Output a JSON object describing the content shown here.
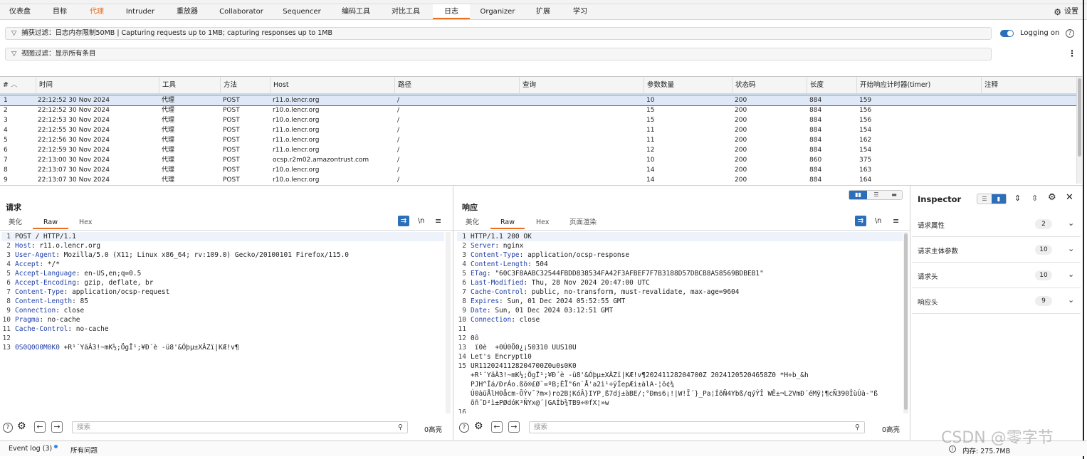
{
  "menubar": {
    "tabs": [
      "仪表盘",
      "目标",
      "代理",
      "Intruder",
      "重放器",
      "Collaborator",
      "Sequencer",
      "编码工具",
      "对比工具",
      "日志",
      "Organizer",
      "扩展",
      "学习"
    ],
    "active_tab": "日志",
    "settings_label": "设置"
  },
  "capture_filter": "捕获过滤：日志内存限制50MB | Capturing requests up to 1MB; capturing responses up to 1MB",
  "view_filter": "视图过滤：显示所有条目",
  "logging_label": "Logging on",
  "table": {
    "columns": [
      "#",
      "时间",
      "工具",
      "方法",
      "Host",
      "路径",
      "查询",
      "参数数量",
      "状态码",
      "长度",
      "开始响应计时器(timer)",
      "注释"
    ],
    "rows": [
      [
        "1",
        "22:12:52 30 Nov 2024",
        "代理",
        "POST",
        "r11.o.lencr.org",
        "/",
        "",
        "10",
        "200",
        "884",
        "159",
        ""
      ],
      [
        "2",
        "22:12:52 30 Nov 2024",
        "代理",
        "POST",
        "r10.o.lencr.org",
        "/",
        "",
        "15",
        "200",
        "884",
        "156",
        ""
      ],
      [
        "3",
        "22:12:53 30 Nov 2024",
        "代理",
        "POST",
        "r10.o.lencr.org",
        "/",
        "",
        "15",
        "200",
        "884",
        "156",
        ""
      ],
      [
        "4",
        "22:12:55 30 Nov 2024",
        "代理",
        "POST",
        "r11.o.lencr.org",
        "/",
        "",
        "11",
        "200",
        "884",
        "154",
        ""
      ],
      [
        "5",
        "22:12:56 30 Nov 2024",
        "代理",
        "POST",
        "r11.o.lencr.org",
        "/",
        "",
        "11",
        "200",
        "884",
        "162",
        ""
      ],
      [
        "6",
        "22:12:59 30 Nov 2024",
        "代理",
        "POST",
        "r11.o.lencr.org",
        "/",
        "",
        "12",
        "200",
        "884",
        "154",
        ""
      ],
      [
        "7",
        "22:13:00 30 Nov 2024",
        "代理",
        "POST",
        "ocsp.r2m02.amazontrust.com",
        "/",
        "",
        "10",
        "200",
        "860",
        "375",
        ""
      ],
      [
        "8",
        "22:13:07 30 Nov 2024",
        "代理",
        "POST",
        "r10.o.lencr.org",
        "/",
        "",
        "14",
        "200",
        "884",
        "163",
        ""
      ],
      [
        "9",
        "22:13:07 30 Nov 2024",
        "代理",
        "POST",
        "r10.o.lencr.org",
        "/",
        "",
        "14",
        "200",
        "884",
        "164",
        ""
      ]
    ]
  },
  "request": {
    "title": "请求",
    "tabs": [
      "美化",
      "Raw",
      "Hex"
    ],
    "active_tab": "Raw",
    "newline_label": "\\n",
    "lines": [
      {
        "n": "1",
        "k": "",
        "v": "POST / HTTP/1.1"
      },
      {
        "n": "2",
        "k": "Host",
        "v": ": r11.o.lencr.org"
      },
      {
        "n": "3",
        "k": "User-Agent",
        "v": ": Mozilla/5.0 (X11; Linux x86_64; rv:109.0) Gecko/20100101 Firefox/115.0"
      },
      {
        "n": "4",
        "k": "Accept",
        "v": ": */*"
      },
      {
        "n": "5",
        "k": "Accept-Language",
        "v": ": en-US,en;q=0.5"
      },
      {
        "n": "6",
        "k": "Accept-Encoding",
        "v": ": gzip, deflate, br"
      },
      {
        "n": "7",
        "k": "Content-Type",
        "v": ": application/ocsp-request"
      },
      {
        "n": "8",
        "k": "Content-Length",
        "v": ": 85"
      },
      {
        "n": "9",
        "k": "Connection",
        "v": ": close"
      },
      {
        "n": "10",
        "k": "Pragma",
        "v": ": no-cache"
      },
      {
        "n": "11",
        "k": "Cache-Control",
        "v": ": no-cache"
      },
      {
        "n": "12",
        "k": "",
        "v": ""
      },
      {
        "n": "13",
        "k": "0S0Q0O0M0K0",
        "v": " +R¹´YäÂ3!~mK½;ÖgÎ¹;¥Đ´è -ü8'&Óþµ±XÂZï|KÆ!v¶"
      }
    ],
    "search_placeholder": "搜索",
    "highlight_count": "0高亮"
  },
  "response": {
    "title": "响应",
    "tabs": [
      "美化",
      "Raw",
      "Hex",
      "页面渲染"
    ],
    "active_tab": "Raw",
    "newline_label": "\\n",
    "lines": [
      {
        "n": "1",
        "k": "",
        "v": "HTTP/1.1 200 OK"
      },
      {
        "n": "2",
        "k": "Server",
        "v": ": nginx"
      },
      {
        "n": "3",
        "k": "Content-Type",
        "v": ": application/ocsp-response"
      },
      {
        "n": "4",
        "k": "Content-Length",
        "v": ": 504"
      },
      {
        "n": "5",
        "k": "ETag",
        "v": ": \"60C3F8AABC32544FBDD838534FA42F3AFBEF7F7B3188D57DBCB8A58569BDBEB1\""
      },
      {
        "n": "6",
        "k": "Last-Modified",
        "v": ": Thu, 28 Nov 2024 20:47:00 UTC"
      },
      {
        "n": "7",
        "k": "Cache-Control",
        "v": ": public, no-transform, must-revalidate, max-age=9604"
      },
      {
        "n": "8",
        "k": "Expires",
        "v": ": Sun, 01 Dec 2024 05:52:55 GMT"
      },
      {
        "n": "9",
        "k": "Date",
        "v": ": Sun, 01 Dec 2024 03:12:51 GMT"
      },
      {
        "n": "10",
        "k": "Connection",
        "v": ": close"
      },
      {
        "n": "11",
        "k": "",
        "v": ""
      },
      {
        "n": "12",
        "k": "",
        "v": "0ô"
      },
      {
        "n": "13",
        "k": "",
        "v": " ï0è  +0Ú0Ö0¿¡50310 UUS10U"
      },
      {
        "n": "14",
        "k": "",
        "v": "Let's Encrypt10"
      },
      {
        "n": "15",
        "k": "",
        "v": "UR1120241128204700Z0u0s0K0"
      },
      {
        "n": "",
        "k": "",
        "v": "+R¹´YäÂ3!~mK½;ÖgÎ¹;¥Đ´è -ü8'&Óþµ±XÂZï|KÆ!v¶20241128204700Z 20241205204658Z0 *H÷b_&h"
      },
      {
        "n": "",
        "k": "",
        "v": "PJH^Íá/ÐrÁo.ßõ®£Ø¨=ºB;ÈÏ\"6n`Å'a2ì¹÷ÿÍepÆi±àlA-¦õ¢¾"
      },
      {
        "n": "",
        "k": "",
        "v": "Ú0àüÅlH0åcm-ÕÝv¯?m×)ro2B¦KóÂ}IYP¸ß7dj±àBE/;°Ðms6¡!|W!Ï´}_Pa¦ÍõÑ4Ybß/qýÝÎ WÊ±¬L2VmÐ´éMÿ¦¶cÑ390ÎùÙà-\"ß"
      },
      {
        "n": "",
        "k": "",
        "v": "õñ¨D²ì±PØdóK³ÑYx@´|GAÍb¾TB9÷®fX¦»w"
      },
      {
        "n": "16",
        "k": "",
        "v": ""
      }
    ],
    "search_placeholder": "搜索",
    "highlight_count": "0高亮"
  },
  "inspector": {
    "title": "Inspector",
    "rows": [
      {
        "label": "请求属性",
        "count": "2"
      },
      {
        "label": "请求主体参数",
        "count": "10"
      },
      {
        "label": "请求头",
        "count": "10"
      },
      {
        "label": "响应头",
        "count": "9"
      }
    ]
  },
  "statusbar": {
    "event_log": "Event log (3)",
    "all_issues": "所有问题",
    "memory": "内存: 275.7MB"
  },
  "watermark": "CSDN @零字节",
  "colors": {
    "accent": "#e8701f",
    "toggle": "#2c6fb8",
    "selection": "#dfe8f6"
  }
}
